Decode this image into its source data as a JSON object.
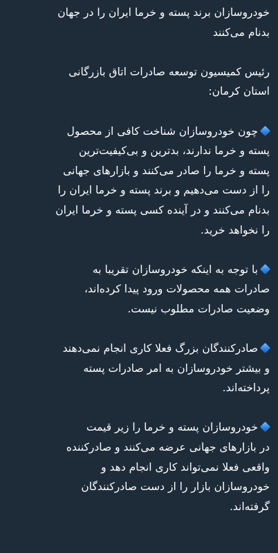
{
  "message": {
    "paragraphs": [
      {
        "id": "p1",
        "bullet": false,
        "lines": [
          "خودروسازان برند پسته و خرما ایران را در جهان",
          "بدنام می‌کنند"
        ]
      },
      {
        "id": "p2",
        "bullet": false,
        "lines": [
          "رئیس کمیسیون توسعه صادرات اتاق بازرگانی",
          "استان کرمان:"
        ]
      },
      {
        "id": "p3",
        "bullet": true,
        "lines": [
          "چون خودروسازان شناخت کافی از محصول",
          "پسته و خرما ندارند، بدترین و بی‌کیفیت‌ترین",
          "پسته و خرما را صادر می‌کنند و بازارهای جهانی",
          "را از دست می‌دهیم و برند پسته و خرما ایران را",
          "بدنام می‌کنند و در آینده کسی پسته و خرما ایران",
          "را نخواهد خرید."
        ]
      },
      {
        "id": "p4",
        "bullet": true,
        "lines": [
          "با توجه به اینکه خودروسازان تقریبا به",
          "صادرات همه محصولات ورود پیدا کرده‌اند،",
          "وضعیت صادرات مطلوب نیست."
        ]
      },
      {
        "id": "p5",
        "bullet": true,
        "lines": [
          "صادرکنندگان بزرگ فعلا کاری انجام نمی‌دهند",
          "و بیشتر خودروسازان به امر صادرات پسته",
          "پرداخته‌اند."
        ]
      },
      {
        "id": "p6",
        "bullet": true,
        "lines": [
          "خودروسازان پسته و خرما را زیر قیمت",
          "در بازارهای جهانی عرضه می‌کنند و صادرکننده",
          "واقعی فعلا نمی‌تواند کاری انجام دهد و",
          "خودروسازان بازار را از دست صادرکنندگان",
          "گرفته‌اند."
        ]
      }
    ]
  },
  "colors": {
    "background": "#1e2c3a",
    "text": "#ffffff",
    "bullet": "#2f86e6"
  },
  "icons": {
    "bullet": "small-blue-diamond-icon"
  }
}
